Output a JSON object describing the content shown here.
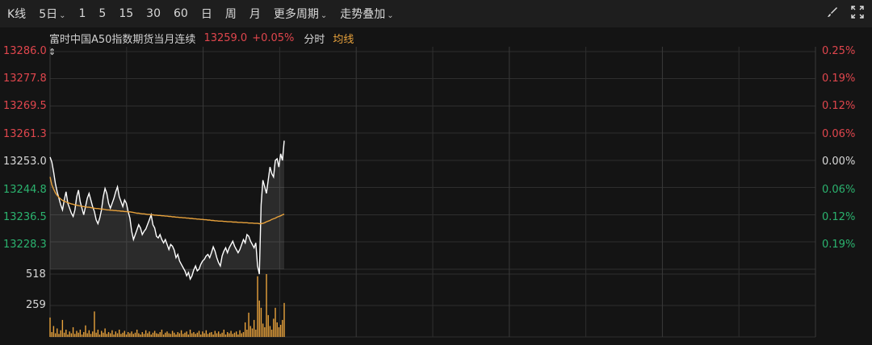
{
  "toolbar": {
    "kline": "K线",
    "period_selected": "5日",
    "periods": [
      "1",
      "5",
      "15",
      "30",
      "60",
      "日",
      "周",
      "月"
    ],
    "more_periods": "更多周期",
    "overlay": "走势叠加",
    "icons": [
      "brush-icon",
      "fullscreen-icon"
    ]
  },
  "info": {
    "name": "富时中国A50指数期货当月连续",
    "price": "13259.0",
    "change_pct": "+0.05%",
    "tab_intraday": "分时",
    "tab_avg": "均线"
  },
  "colors": {
    "up": "#e0464d",
    "down": "#2bb36f",
    "price_line": "#ffffff",
    "avg_line": "#e8a23c",
    "volume": "#e8a23c",
    "grid": "#2e2e2e"
  },
  "chart_data": {
    "type": "line",
    "series": [
      {
        "name": "",
        "values": [
          13254.0,
          13252.5,
          13249.5,
          13246.0,
          13243.5,
          13241.5,
          13239.5,
          13238.0,
          13241.0,
          13243.5,
          13240.0,
          13238.5,
          13237.0,
          13236.0,
          13238.0,
          13242.0,
          13244.0,
          13240.5,
          13238.5,
          13236.5,
          13239.0,
          13241.5,
          13243.0,
          13241.0,
          13239.0,
          13237.5,
          13235.0,
          13233.8,
          13235.5,
          13238.0,
          13242.0,
          13244.5,
          13243.0,
          13240.0,
          13238.5,
          13240.0,
          13241.5,
          13243.5,
          13245.0,
          13242.0,
          13240.5,
          13239.0,
          13241.0,
          13240.0,
          13237.5,
          13235.5,
          13231.5,
          13229.0,
          13230.5,
          13232.0,
          13233.5,
          13232.5,
          13230.5,
          13231.5,
          13232.2,
          13233.6,
          13235.0,
          13236.5,
          13233.5,
          13232.5,
          13230.0,
          13229.5,
          13230.5,
          13229.0,
          13228.0,
          13229.0,
          13227.5,
          13226.0,
          13227.5,
          13227.0,
          13225.8,
          13223.5,
          13224.5,
          13222.5,
          13221.5,
          13220.5,
          13219.5,
          13218.0,
          13219.0,
          13217.0,
          13218.0,
          13219.8,
          13221.0,
          13219.5,
          13220.0,
          13221.5,
          13222.5,
          13223.0,
          13224.0,
          13224.5,
          13223.5,
          13225.0,
          13226.8,
          13225.5,
          13223.5,
          13222.0,
          13221.0,
          13224.0,
          13225.5,
          13226.5,
          13225.0,
          13226.5,
          13227.5,
          13228.5,
          13227.0,
          13226.0,
          13225.0,
          13226.0,
          13227.5,
          13229.0,
          13228.0,
          13230.5,
          13230.0,
          13228.5,
          13227.5,
          13226.5,
          13228.0,
          13221.0,
          13218.5,
          13239.5,
          13247.0,
          13245.0,
          13243.0,
          13247.0,
          13251.0,
          13249.0,
          13248.0,
          13253.0,
          13253.5,
          13251.0,
          13255.0,
          13253.0,
          13259.0
        ],
        "color": "#ffffff"
      },
      {
        "name": "均线",
        "values": [
          13248.0,
          13245.6,
          13244.3,
          13243.2,
          13242.4,
          13241.8,
          13241.3,
          13240.9,
          13240.6,
          13240.4,
          13240.2,
          13240.0,
          13239.8,
          13239.7,
          13239.5,
          13239.4,
          13239.3,
          13239.2,
          13239.1,
          13239.0,
          13238.9,
          13238.8,
          13238.8,
          13238.7,
          13238.6,
          13238.5,
          13238.4,
          13238.4,
          13238.3,
          13238.2,
          13238.2,
          13238.1,
          13238.0,
          13238.0,
          13237.9,
          13237.9,
          13237.8,
          13237.8,
          13237.7,
          13237.7,
          13237.6,
          13237.6,
          13237.5,
          13237.5,
          13237.4,
          13237.4,
          13237.3,
          13237.2,
          13237.1,
          13237.0,
          13237.0,
          13236.9,
          13236.8,
          13236.8,
          13236.7,
          13236.6,
          13236.6,
          13236.5,
          13236.5,
          13236.4,
          13236.4,
          13236.3,
          13236.3,
          13236.2,
          13236.2,
          13236.1,
          13236.1,
          13236.0,
          13236.0,
          13235.9,
          13235.9,
          13235.8,
          13235.8,
          13235.7,
          13235.7,
          13235.6,
          13235.6,
          13235.5,
          13235.5,
          13235.4,
          13235.4,
          13235.3,
          13235.3,
          13235.2,
          13235.2,
          13235.1,
          13235.1,
          13235.0,
          13235.0,
          13234.9,
          13234.9,
          13234.8,
          13234.8,
          13234.7,
          13234.7,
          13234.6,
          13234.6,
          13234.6,
          13234.5,
          13234.5,
          13234.4,
          13234.4,
          13234.4,
          13234.3,
          13234.3,
          13234.3,
          13234.2,
          13234.2,
          13234.2,
          13234.1,
          13234.1,
          13234.1,
          13234.0,
          13234.0,
          13234.0,
          13233.9,
          13233.9,
          13233.9,
          13233.8,
          13233.8,
          13233.9,
          13234.1,
          13234.4,
          13234.6,
          13234.8,
          13235.1,
          13235.3,
          13235.5,
          13235.8,
          13236.0,
          13236.2,
          13236.5,
          13236.7
        ],
        "color": "#e8a23c"
      }
    ],
    "volume": [
      160,
      40,
      90,
      30,
      70,
      25,
      55,
      140,
      35,
      60,
      20,
      45,
      30,
      80,
      25,
      50,
      35,
      60,
      20,
      40,
      95,
      30,
      55,
      25,
      45,
      210,
      35,
      60,
      20,
      50,
      35,
      70,
      25,
      40,
      30,
      55,
      20,
      45,
      30,
      60,
      25,
      35,
      50,
      20,
      40,
      30,
      45,
      25,
      35,
      60,
      30,
      20,
      40,
      25,
      55,
      30,
      45,
      20,
      35,
      50,
      30,
      25,
      40,
      60,
      20,
      35,
      45,
      30,
      25,
      50,
      35,
      20,
      40,
      30,
      55,
      25,
      35,
      45,
      20,
      60,
      30,
      40,
      25,
      35,
      50,
      20,
      45,
      30,
      55,
      25,
      35,
      40,
      20,
      50,
      30,
      45,
      25,
      35,
      60,
      20,
      40,
      30,
      50,
      25,
      35,
      45,
      20,
      55,
      30,
      40,
      120,
      60,
      200,
      90,
      70,
      140,
      60,
      500,
      300,
      240,
      110,
      80,
      520,
      180,
      90,
      60,
      150,
      240,
      120,
      80,
      100,
      140,
      280
    ],
    "y_axis_left": [
      "13286.0",
      "13277.8",
      "13269.5",
      "13261.3",
      "13253.0",
      "13244.8",
      "13236.5",
      "13228.3"
    ],
    "y_axis_right": [
      "0.25%",
      "0.19%",
      "0.12%",
      "0.06%",
      "0.00%",
      "0.06%",
      "0.12%",
      "0.19%"
    ],
    "ylim": [
      13220.0,
      13286.0
    ],
    "base_price": 13253.0,
    "volume_axis": [
      "518",
      "259"
    ],
    "volume_max": 518,
    "x_days_total": 5,
    "x_days_filled": 0.3,
    "grid": true
  }
}
